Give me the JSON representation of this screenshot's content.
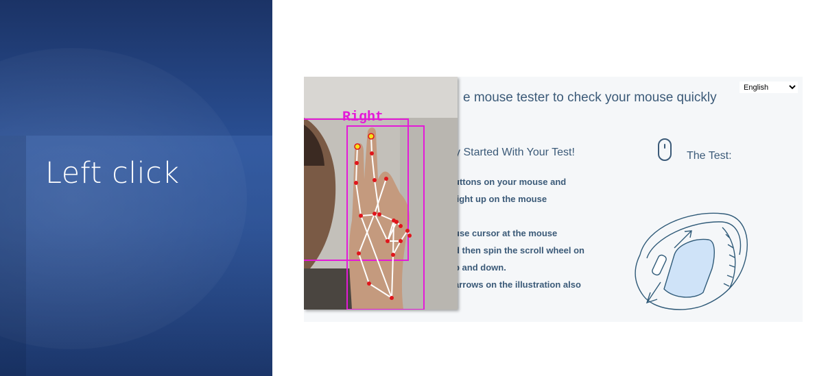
{
  "slide": {
    "title": "Left click"
  },
  "tester": {
    "language": "English",
    "heading": "e mouse tester to check your mouse quickly",
    "subheading": "y Started With Your Test!",
    "instructions": [
      "uttons on your mouse and",
      "light up on the mouse",
      "use cursor at the mouse",
      "d then spin the scroll wheel on",
      "p and down.",
      "arrows on the illustration also"
    ],
    "test_label": "The Test:"
  },
  "webcam": {
    "overlay_label": "Right"
  },
  "colors": {
    "overlay": "#e419d8",
    "landmark": "#e0151b",
    "tip": "#f4e11a",
    "text": "#3b5a78"
  },
  "icons": [
    "mouse-outline-icon",
    "mouse-illustration-icon",
    "chevron-down-icon"
  ]
}
